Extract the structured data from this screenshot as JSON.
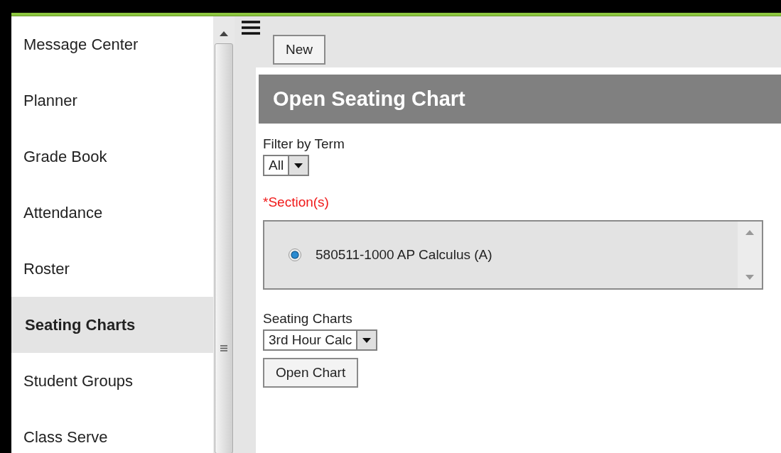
{
  "sidebar": {
    "items": [
      {
        "label": "Message Center",
        "selected": false
      },
      {
        "label": "Planner",
        "selected": false
      },
      {
        "label": "Grade Book",
        "selected": false
      },
      {
        "label": "Attendance",
        "selected": false
      },
      {
        "label": "Roster",
        "selected": false
      },
      {
        "label": "Seating Charts",
        "selected": true
      },
      {
        "label": "Student Groups",
        "selected": false
      },
      {
        "label": "Class Serve",
        "selected": false
      }
    ]
  },
  "toolbar": {
    "new_button": "New"
  },
  "panel": {
    "title": "Open Seating Chart",
    "filter": {
      "label": "Filter by Term",
      "value": "All"
    },
    "sections": {
      "label": "*Section(s)",
      "options": [
        {
          "label": "580511-1000 AP Calculus (A)",
          "selected": true
        }
      ]
    },
    "seating_charts": {
      "label": "Seating Charts",
      "value": "3rd Hour Calc"
    },
    "open_button": "Open Chart"
  }
}
